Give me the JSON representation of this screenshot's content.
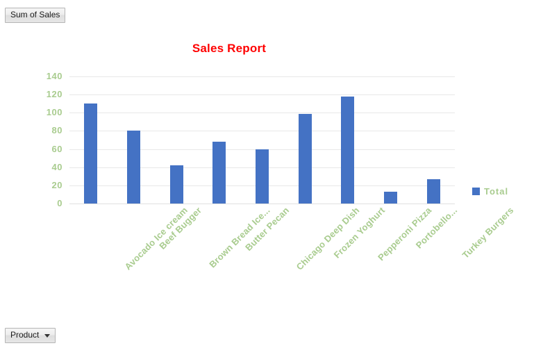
{
  "toolbar": {
    "measure_button": "Sum of Sales",
    "product_button": "Product",
    "caret_icon": "chevron-down-icon"
  },
  "chart_data": {
    "type": "bar",
    "title": "Sales Report",
    "xlabel": "",
    "ylabel": "",
    "ylim": [
      0,
      140
    ],
    "ytick_step": 20,
    "yticks": [
      140,
      120,
      100,
      80,
      60,
      40,
      20,
      0
    ],
    "grid": true,
    "legend_position": "right",
    "categories": [
      "Avocado Ice cream",
      "Beef Bugger",
      "Brown Bread Ice...",
      "Butter Pecan",
      "Chicago Deep Dish",
      "Frozen Yoghurt",
      "Pepperoni Pizza",
      "Portobello...",
      "Turkey Burgers"
    ],
    "series": [
      {
        "name": "Total",
        "color": "#4472c4",
        "values": [
          110,
          80,
          42,
          68,
          60,
          99,
          118,
          13,
          27
        ]
      }
    ],
    "colors": {
      "title": "#ff0000",
      "axis_text": "#a9cc8f",
      "bar": "#4472c4",
      "gridline": "#e8e8e8",
      "background": "#ffffff"
    }
  }
}
